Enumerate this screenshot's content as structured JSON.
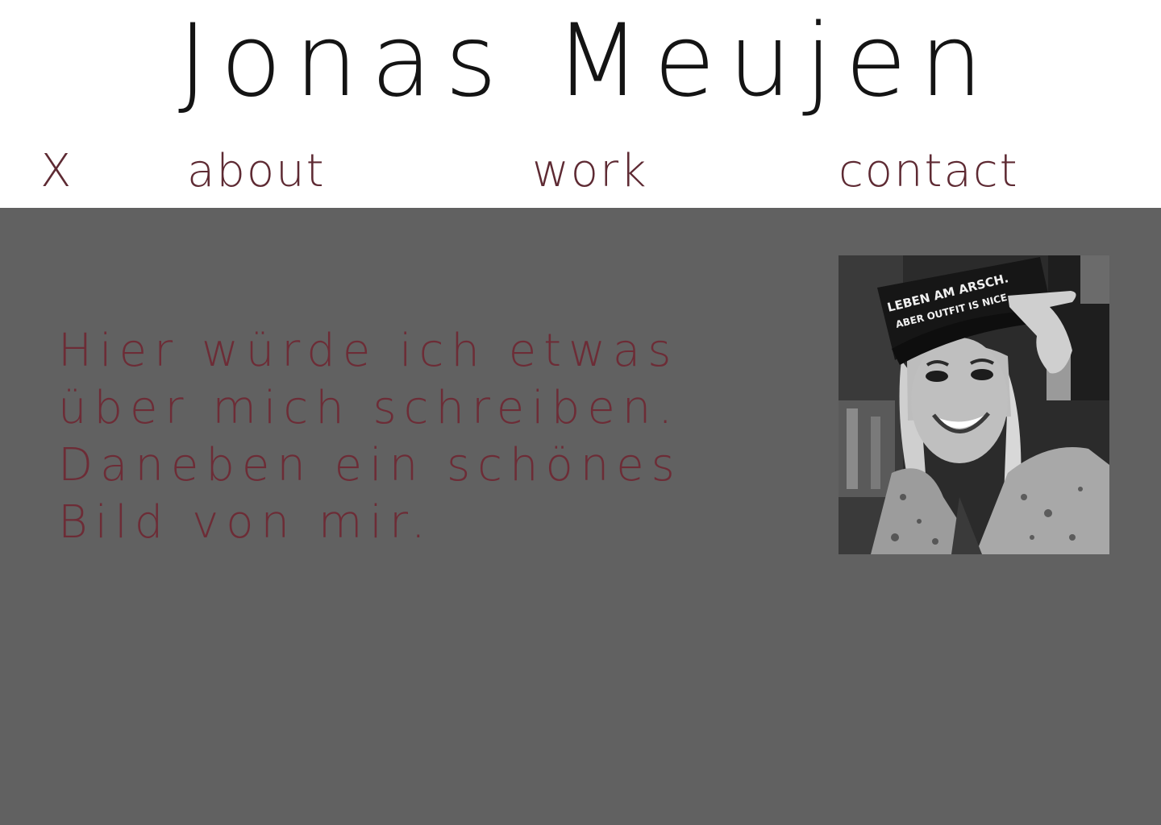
{
  "header": {
    "site_title": "Jonas Meujen"
  },
  "nav": {
    "close_label": "X",
    "items": [
      {
        "label": "about"
      },
      {
        "label": "work"
      },
      {
        "label": "contact"
      }
    ]
  },
  "main": {
    "about_lines": [
      "Hier würde ich etwas",
      "über mich schreiben.",
      "Daneben ein schönes",
      "Bild von mir."
    ],
    "portrait": {
      "cap_text_line1": "LEBEN AM ARSCH.",
      "cap_text_line2": "ABER OUTFIT IS NICE."
    }
  },
  "colors": {
    "nav_text": "#5e2a33",
    "body_text": "#6d2c36",
    "main_background": "#616161",
    "header_background": "#ffffff"
  }
}
